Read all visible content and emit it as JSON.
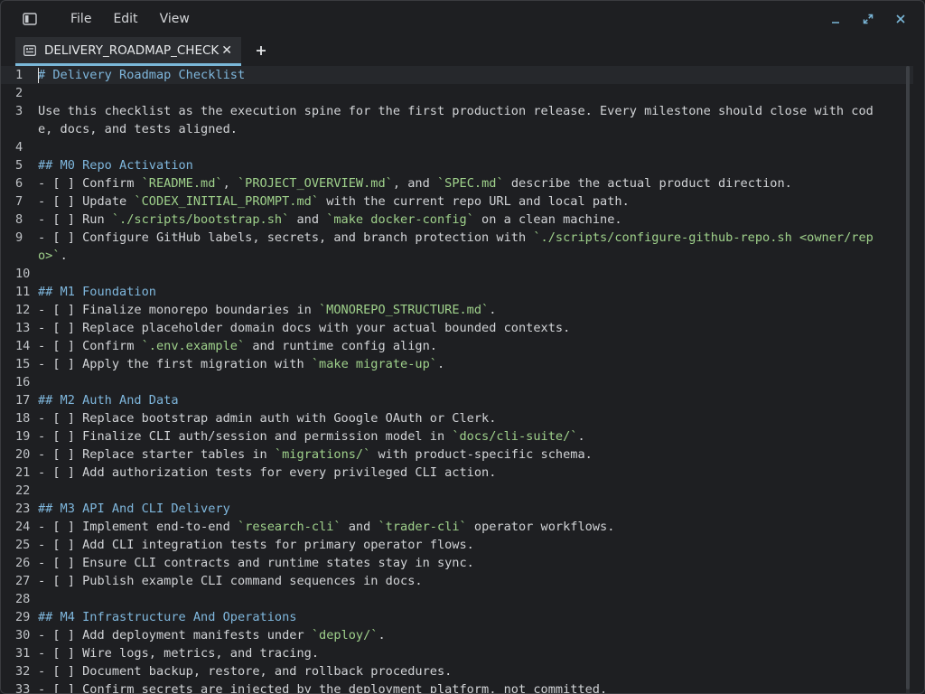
{
  "menu": {
    "items": [
      "File",
      "Edit",
      "View"
    ]
  },
  "tab": {
    "title": "DELIVERY_ROADMAP_CHECKI",
    "close": "✕",
    "new_tab": "+"
  },
  "editor": {
    "lines": [
      {
        "n": "1",
        "parts": [
          {
            "t": "h",
            "v": "# Delivery Roadmap Checklist"
          }
        ]
      },
      {
        "n": "2",
        "parts": []
      },
      {
        "n": "3",
        "parts": [
          {
            "t": "p",
            "v": "Use this checklist as the execution spine for the first production release. Every milestone should close with code, docs, and tests aligned."
          }
        ]
      },
      {
        "n": "4",
        "parts": []
      },
      {
        "n": "5",
        "parts": [
          {
            "t": "h",
            "v": "## M0 Repo Activation"
          }
        ]
      },
      {
        "n": "6",
        "parts": [
          {
            "t": "p",
            "v": "- [ ] Confirm "
          },
          {
            "t": "c",
            "v": "`README.md`"
          },
          {
            "t": "p",
            "v": ", "
          },
          {
            "t": "c",
            "v": "`PROJECT_OVERVIEW.md`"
          },
          {
            "t": "p",
            "v": ", and "
          },
          {
            "t": "c",
            "v": "`SPEC.md`"
          },
          {
            "t": "p",
            "v": " describe the actual product direction."
          }
        ]
      },
      {
        "n": "7",
        "parts": [
          {
            "t": "p",
            "v": "- [ ] Update "
          },
          {
            "t": "c",
            "v": "`CODEX_INITIAL_PROMPT.md`"
          },
          {
            "t": "p",
            "v": " with the current repo URL and local path."
          }
        ]
      },
      {
        "n": "8",
        "parts": [
          {
            "t": "p",
            "v": "- [ ] Run "
          },
          {
            "t": "c",
            "v": "`./scripts/bootstrap.sh`"
          },
          {
            "t": "p",
            "v": " and "
          },
          {
            "t": "c",
            "v": "`make docker-config`"
          },
          {
            "t": "p",
            "v": " on a clean machine."
          }
        ]
      },
      {
        "n": "9",
        "parts": [
          {
            "t": "p",
            "v": "- [ ] Configure GitHub labels, secrets, and branch protection with "
          },
          {
            "t": "c",
            "v": "`./scripts/configure-github-repo.sh <owner/repo>`"
          },
          {
            "t": "p",
            "v": "."
          }
        ]
      },
      {
        "n": "10",
        "parts": []
      },
      {
        "n": "11",
        "parts": [
          {
            "t": "h",
            "v": "## M1 Foundation"
          }
        ]
      },
      {
        "n": "12",
        "parts": [
          {
            "t": "p",
            "v": "- [ ] Finalize monorepo boundaries in "
          },
          {
            "t": "c",
            "v": "`MONOREPO_STRUCTURE.md`"
          },
          {
            "t": "p",
            "v": "."
          }
        ]
      },
      {
        "n": "13",
        "parts": [
          {
            "t": "p",
            "v": "- [ ] Replace placeholder domain docs with your actual bounded contexts."
          }
        ]
      },
      {
        "n": "14",
        "parts": [
          {
            "t": "p",
            "v": "- [ ] Confirm "
          },
          {
            "t": "c",
            "v": "`.env.example`"
          },
          {
            "t": "p",
            "v": " and runtime config align."
          }
        ]
      },
      {
        "n": "15",
        "parts": [
          {
            "t": "p",
            "v": "- [ ] Apply the first migration with "
          },
          {
            "t": "c",
            "v": "`make migrate-up`"
          },
          {
            "t": "p",
            "v": "."
          }
        ]
      },
      {
        "n": "16",
        "parts": []
      },
      {
        "n": "17",
        "parts": [
          {
            "t": "h",
            "v": "## M2 Auth And Data"
          }
        ]
      },
      {
        "n": "18",
        "parts": [
          {
            "t": "p",
            "v": "- [ ] Replace bootstrap admin auth with Google OAuth or Clerk."
          }
        ]
      },
      {
        "n": "19",
        "parts": [
          {
            "t": "p",
            "v": "- [ ] Finalize CLI auth/session and permission model in "
          },
          {
            "t": "c",
            "v": "`docs/cli-suite/`"
          },
          {
            "t": "p",
            "v": "."
          }
        ]
      },
      {
        "n": "20",
        "parts": [
          {
            "t": "p",
            "v": "- [ ] Replace starter tables in "
          },
          {
            "t": "c",
            "v": "`migrations/`"
          },
          {
            "t": "p",
            "v": " with product-specific schema."
          }
        ]
      },
      {
        "n": "21",
        "parts": [
          {
            "t": "p",
            "v": "- [ ] Add authorization tests for every privileged CLI action."
          }
        ]
      },
      {
        "n": "22",
        "parts": []
      },
      {
        "n": "23",
        "parts": [
          {
            "t": "h",
            "v": "## M3 API And CLI Delivery"
          }
        ]
      },
      {
        "n": "24",
        "parts": [
          {
            "t": "p",
            "v": "- [ ] Implement end-to-end "
          },
          {
            "t": "c",
            "v": "`research-cli`"
          },
          {
            "t": "p",
            "v": " and "
          },
          {
            "t": "c",
            "v": "`trader-cli`"
          },
          {
            "t": "p",
            "v": " operator workflows."
          }
        ]
      },
      {
        "n": "25",
        "parts": [
          {
            "t": "p",
            "v": "- [ ] Add CLI integration tests for primary operator flows."
          }
        ]
      },
      {
        "n": "26",
        "parts": [
          {
            "t": "p",
            "v": "- [ ] Ensure CLI contracts and runtime states stay in sync."
          }
        ]
      },
      {
        "n": "27",
        "parts": [
          {
            "t": "p",
            "v": "- [ ] Publish example CLI command sequences in docs."
          }
        ]
      },
      {
        "n": "28",
        "parts": []
      },
      {
        "n": "29",
        "parts": [
          {
            "t": "h",
            "v": "## M4 Infrastructure And Operations"
          }
        ]
      },
      {
        "n": "30",
        "parts": [
          {
            "t": "p",
            "v": "- [ ] Add deployment manifests under "
          },
          {
            "t": "c",
            "v": "`deploy/`"
          },
          {
            "t": "p",
            "v": "."
          }
        ]
      },
      {
        "n": "31",
        "parts": [
          {
            "t": "p",
            "v": "- [ ] Wire logs, metrics, and tracing."
          }
        ]
      },
      {
        "n": "32",
        "parts": [
          {
            "t": "p",
            "v": "- [ ] Document backup, restore, and rollback procedures."
          }
        ]
      },
      {
        "n": "33",
        "parts": [
          {
            "t": "p",
            "v": "- [ ] Confirm secrets are injected by the deployment platform, not committed."
          }
        ]
      }
    ]
  },
  "colors": {
    "heading": "#7fb7dd",
    "code": "#9fd18b",
    "text": "#d2d4d7",
    "tab_accent": "#7ab7d8",
    "background": "#1e1f22"
  }
}
